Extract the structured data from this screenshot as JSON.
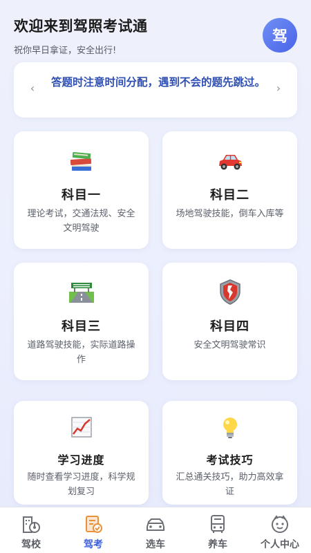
{
  "header": {
    "title": "欢迎来到驾照考试通",
    "subtitle": "祝你早日拿证，安全出行!",
    "avatar_text": "驾"
  },
  "tip": {
    "text": "答题时注意时间分配，遇到不会的题先跳过。",
    "prev_icon": "‹",
    "next_icon": "›"
  },
  "cards": [
    {
      "title": "科目一",
      "desc": "理论考试，交通法规、安全文明驾驶",
      "icon": "books-icon"
    },
    {
      "title": "科目二",
      "desc": "场地驾驶技能，倒车入库等",
      "icon": "car-icon"
    },
    {
      "title": "科目三",
      "desc": "道路驾驶技能，实际道路操作",
      "icon": "road-icon"
    },
    {
      "title": "科目四",
      "desc": "安全文明驾驶常识",
      "icon": "shield-icon"
    },
    {
      "title": "学习进度",
      "desc": "随时查看学习进度，科学规划复习",
      "icon": "chart-increasing-icon"
    },
    {
      "title": "考试技巧",
      "desc": "汇总通关技巧，助力高效拿证",
      "icon": "lightbulb-icon"
    }
  ],
  "tabs": [
    {
      "label": "驾校",
      "icon": "school-icon",
      "active": false
    },
    {
      "label": "驾考",
      "icon": "exam-icon",
      "active": true
    },
    {
      "label": "选车",
      "icon": "car-outline-icon",
      "active": false
    },
    {
      "label": "养车",
      "icon": "bus-icon",
      "active": false
    },
    {
      "label": "个人中心",
      "icon": "profile-icon",
      "active": false
    }
  ],
  "colors": {
    "accent": "#3c5fe0",
    "tip_text": "#2f4fb3",
    "tab_inactive": "#5a5d63"
  }
}
